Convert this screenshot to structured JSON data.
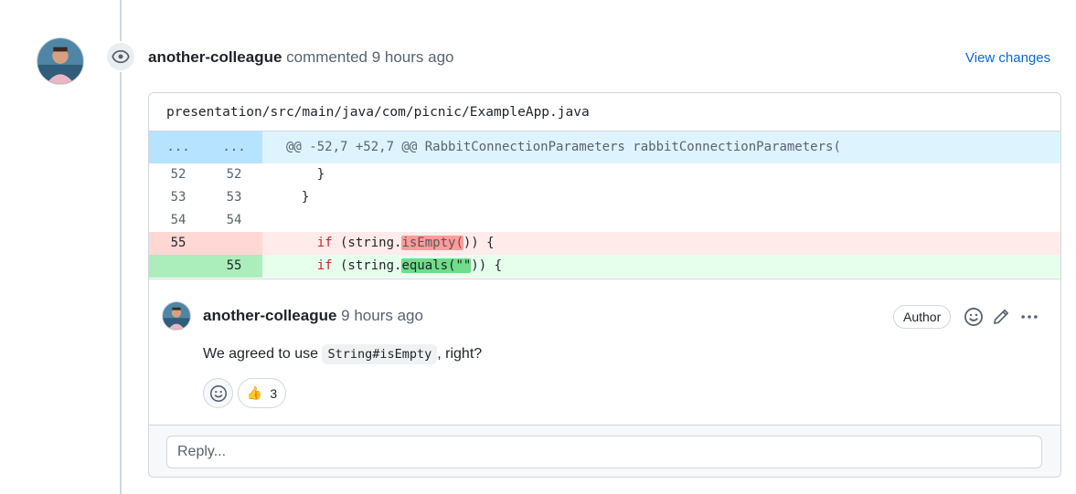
{
  "timeline": {
    "author": "another-colleague",
    "action": "commented",
    "time": "9 hours ago",
    "view_changes": "View changes"
  },
  "file": {
    "path": "presentation/src/main/java/com/picnic/ExampleApp.java"
  },
  "diff": {
    "hunk": {
      "old": "...",
      "new": "...",
      "text": "@@ -52,7 +52,7 @@ RabbitConnectionParameters rabbitConnectionParameters("
    },
    "lines": [
      {
        "type": "context",
        "old": "52",
        "new": "52",
        "code": "    }"
      },
      {
        "type": "context",
        "old": "53",
        "new": "53",
        "code": "  }"
      },
      {
        "type": "context",
        "old": "54",
        "new": "54",
        "code": ""
      },
      {
        "type": "del",
        "old": "55",
        "new": "",
        "kw": "if",
        "pre": " (string.",
        "hl": "isEmpty(",
        "post": ")) {"
      },
      {
        "type": "add",
        "old": "",
        "new": "55",
        "kw": "if",
        "pre": " (string.",
        "hl": "equals(\"\"",
        "post": ")) {"
      }
    ]
  },
  "comment": {
    "author": "another-colleague",
    "time": "9 hours ago",
    "badge": "Author",
    "body_pre": "We agreed to use ",
    "body_code": "String#isEmpty",
    "body_post": ", right?",
    "reactions": [
      {
        "emoji": "👍",
        "count": "3"
      }
    ]
  },
  "reply": {
    "placeholder": "Reply..."
  },
  "colors": {
    "link": "#0969da",
    "hunk_bg": "#ddf4ff",
    "del_bg": "#ffebe9",
    "add_bg": "#e6ffec"
  },
  "icons": [
    "eye-icon",
    "smiley-icon",
    "pencil-icon",
    "kebab-horizontal-icon",
    "thumbs-up-icon"
  ]
}
